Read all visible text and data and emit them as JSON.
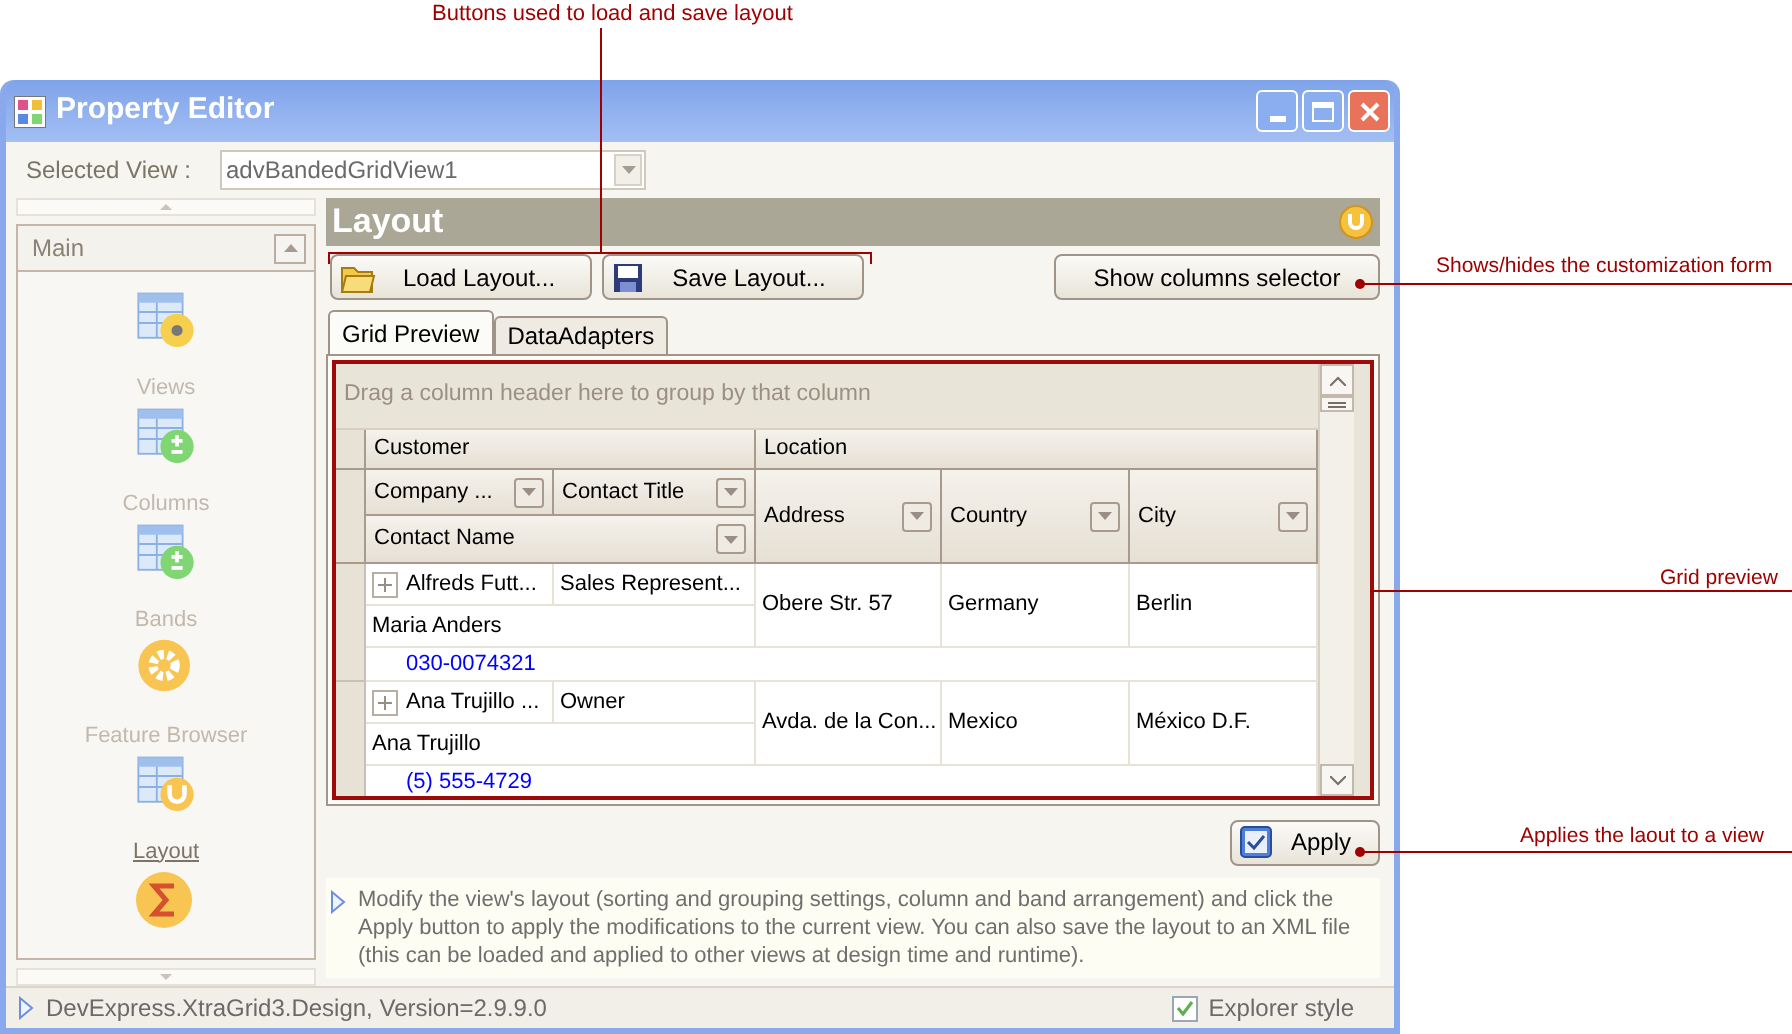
{
  "callouts": [
    {
      "text": "Buttons used to load and save layout"
    },
    {
      "text": "Shows/hides the customization form"
    },
    {
      "text": "Grid preview"
    },
    {
      "text": "Applies the laout to a view"
    }
  ],
  "window": {
    "title": "Property Editor"
  },
  "selected_view": {
    "label": "Selected View :",
    "value": "advBandedGridView1"
  },
  "nav": {
    "group": "Main",
    "items": [
      {
        "label": "Views",
        "kind": "table-dot",
        "selected": false
      },
      {
        "label": "Columns",
        "kind": "table-plus",
        "selected": false
      },
      {
        "label": "Bands",
        "kind": "table-plus",
        "selected": false
      },
      {
        "label": "Feature Browser",
        "kind": "gear",
        "selected": false
      },
      {
        "label": "Layout",
        "kind": "table-wrench",
        "selected": true
      },
      {
        "kind": "sigma"
      }
    ]
  },
  "panel": {
    "title": "Layout"
  },
  "buttons": [
    {
      "label": "Load Layout...",
      "kind": "open"
    },
    {
      "label": "Save Layout...",
      "kind": "save"
    }
  ],
  "selector_button": {
    "label": "Show columns selector"
  },
  "tabs": [
    {
      "label": "Grid Preview",
      "selected": true
    },
    {
      "label": "DataAdapters",
      "selected": false
    }
  ],
  "grid": {
    "group_panel": "Drag a column header here to group by that column",
    "bands": [
      "Customer",
      "Location"
    ],
    "columns": [
      "Company ...",
      "Contact Title",
      "Contact Name",
      "Address",
      "Country",
      "City"
    ],
    "rows": [
      {
        "expanded": false,
        "company": "Alfreds Futt...",
        "title": "Sales Represent...",
        "name": "Maria Anders",
        "address": "Obere Str. 57",
        "country": "Germany",
        "city": "Berlin",
        "phone": "030-0074321"
      },
      {
        "expanded": false,
        "company": "Ana Trujillo ...",
        "title": "Owner",
        "name": "Ana Trujillo",
        "address": "Avda. de la Con...",
        "country": "Mexico",
        "city": "México D.F.",
        "phone": "(5) 555-4729"
      }
    ]
  },
  "apply_button": {
    "label": "Apply"
  },
  "description": "Modify the view's layout (sorting and grouping settings, column and band arrangement) and click the Apply button to apply the modifications to the current view. You can also save the layout to an XML file (this can be loaded and applied to other views at design time and runtime).",
  "status_bar": {
    "text": "DevExpress.XtraGrid3.Design, Version=2.9.9.0",
    "explorer_style": {
      "label": "Explorer style",
      "checked": true
    }
  }
}
